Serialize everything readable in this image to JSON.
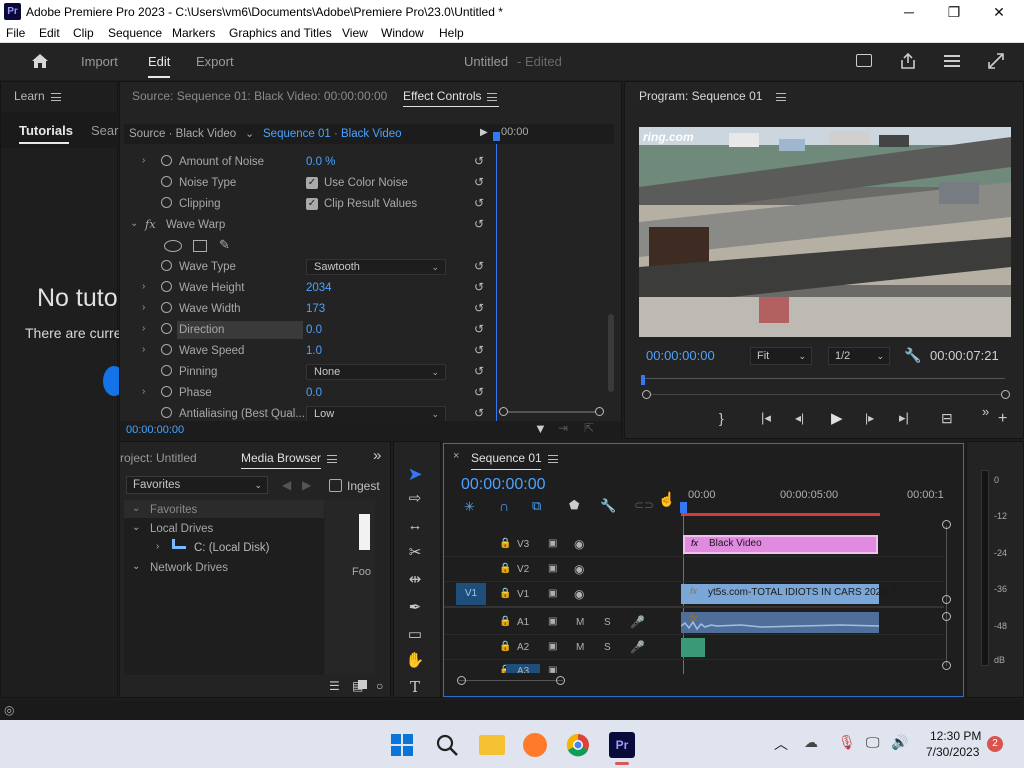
{
  "window": {
    "app_icon": "Pr",
    "title": "Adobe Premiere Pro 2023 - C:\\Users\\vm6\\Documents\\Adobe\\Premiere Pro\\23.0\\Untitled *",
    "minimize": "─",
    "maximize": "❐",
    "close": "✕"
  },
  "menu": [
    "File",
    "Edit",
    "Clip",
    "Sequence",
    "Markers",
    "Graphics and Titles",
    "View",
    "Window",
    "Help"
  ],
  "header": {
    "home_icon": "home-icon",
    "tabs": [
      "Import",
      "Edit",
      "Export"
    ],
    "active_tab": "Edit",
    "project_name": "Untitled",
    "project_status": "- Edited"
  },
  "learn": {
    "title": "Learn",
    "tabs": [
      "Tutorials",
      "Sear"
    ],
    "no_tut": "No tuto",
    "no_tut_sub": "There are curre"
  },
  "effect_controls": {
    "source_tab": "Source: Sequence 01: Black Video: 00:00:00:00",
    "title": "Effect Controls",
    "source_label": "Source · Black Video",
    "seq_label": "Sequence 01 · Black Video",
    "ruler_time": "00:00",
    "amount_noise": {
      "label": "Amount of Noise",
      "value": "0.0 %"
    },
    "noise_type": {
      "label": "Noise Type",
      "value": "Use Color Noise"
    },
    "clipping": {
      "label": "Clipping",
      "value": "Clip Result Values"
    },
    "wave_warp": "Wave Warp",
    "fx_label": "fx",
    "wave_type": {
      "label": "Wave Type",
      "value": "Sawtooth"
    },
    "wave_height": {
      "label": "Wave Height",
      "value": "2034"
    },
    "wave_width": {
      "label": "Wave Width",
      "value": "173"
    },
    "direction": {
      "label": "Direction",
      "value": "0.0"
    },
    "wave_speed": {
      "label": "Wave Speed",
      "value": "1.0"
    },
    "pinning": {
      "label": "Pinning",
      "value": "None"
    },
    "phase": {
      "label": "Phase",
      "value": "0.0"
    },
    "antialiasing": {
      "label": "Antialiasing (Best Qual...",
      "value": "Low"
    },
    "timecode": "00:00:00:00"
  },
  "program": {
    "title": "Program: Sequence 01",
    "watermark": "ring.com",
    "timecode": "00:00:00:00",
    "fit": "Fit",
    "quality": "1/2",
    "duration": "00:00:07:21"
  },
  "project": {
    "tab1": "roject: Untitled",
    "tab2": "Media Browser",
    "favorites_select": "Favorites",
    "ingest": "Ingest",
    "tree": {
      "favorites": "Favorites",
      "local_drives": "Local Drives",
      "c_drive": "C: (Local Disk)",
      "network_drives": "Network Drives"
    },
    "thumb_label": "Foo"
  },
  "timeline": {
    "title": "Sequence 01",
    "timecode": "00:00:00:00",
    "ruler": [
      "00:00",
      "00:00:05:00",
      "00:00:1"
    ],
    "tracks_video": [
      "V3",
      "V2",
      "V1"
    ],
    "tracks_audio": [
      "A1",
      "A2",
      "A3"
    ],
    "v1_source": "V1",
    "mute": "M",
    "solo": "S",
    "clip_v3": "Black Video",
    "clip_v1": "yt5s.com-TOTAL IDIOTS IN CARS 2023_T",
    "fx_badge": "fx"
  },
  "meter": {
    "ticks": [
      "0",
      "-12",
      "-24",
      "-36",
      "-48",
      "dB"
    ]
  },
  "taskbar": {
    "time": "12:30 PM",
    "date": "7/30/2023",
    "notif": "2"
  },
  "colors": {
    "accent": "#4aa3ff",
    "clip_pink": "#e08ae0",
    "clip_blue": "#7aa7d8",
    "playhead": "#2f7fff",
    "audio_green": "#3a9a78"
  }
}
